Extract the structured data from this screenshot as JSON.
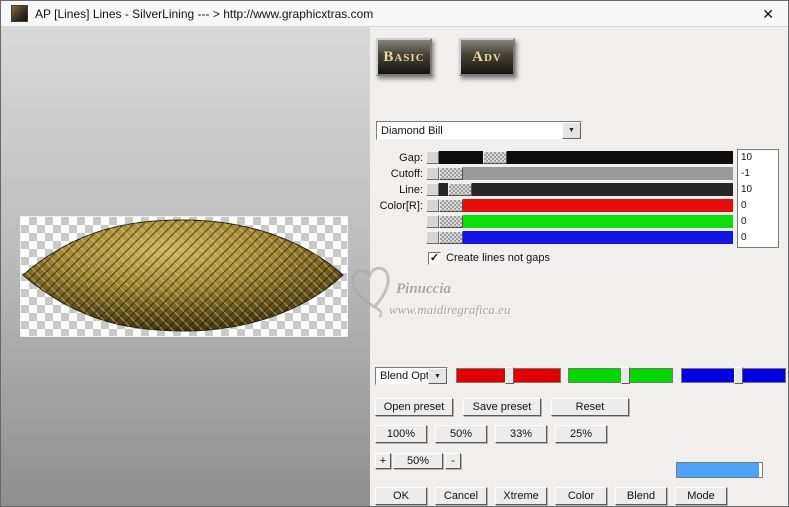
{
  "window": {
    "title": "AP [Lines]  Lines - SilverLining    --- > http://www.graphicxtras.com",
    "close_glyph": "✕"
  },
  "icons": {
    "dropdown_arrow": "▼",
    "check": "✓"
  },
  "tabs": {
    "basic": "Basic",
    "adv": "Adv"
  },
  "preset_combo": {
    "value": "Diamond Bill"
  },
  "params": {
    "rows": [
      {
        "label": "Gap:",
        "value": "10",
        "track_color": "#0d0d0d",
        "thumb_pct": 15
      },
      {
        "label": "Cutoff:",
        "value": "-1",
        "track_color": "#9a9a9a",
        "thumb_pct": 0
      },
      {
        "label": "Line:",
        "value": "10",
        "track_color": "#262626",
        "thumb_pct": 3
      },
      {
        "label": "Color[R]:",
        "value": "0",
        "track_color": "#e60d0d",
        "thumb_pct": 0
      },
      {
        "label": "",
        "value": "0",
        "track_color": "#0ddf0d",
        "thumb_pct": 0
      },
      {
        "label": "",
        "value": "0",
        "track_color": "#1414e6",
        "thumb_pct": 0
      }
    ]
  },
  "options": {
    "create_lines_label": "Create lines not gaps",
    "checked": true
  },
  "watermark": {
    "name": "Pinuccia",
    "site": "www.maidiregrafica.eu"
  },
  "blend": {
    "combo_value": "Blend Opti",
    "channels": [
      {
        "name": "red",
        "color": "#e00000",
        "thumb_pct": 47
      },
      {
        "name": "green",
        "color": "#00d800",
        "thumb_pct": 50
      },
      {
        "name": "blue",
        "color": "#0000e0",
        "thumb_pct": 50
      }
    ]
  },
  "preset_buttons": {
    "open": "Open preset",
    "save": "Save preset",
    "reset": "Reset"
  },
  "zoom_buttons": [
    "100%",
    "50%",
    "33%",
    "25%"
  ],
  "zoom_stepper": {
    "plus": "+",
    "value": "50%",
    "minus": "-"
  },
  "progress": {
    "color": "#4da3f8",
    "pct": 97
  },
  "action_buttons": [
    "OK",
    "Cancel",
    "Xtreme",
    "Color",
    "Blend",
    "Mode"
  ]
}
